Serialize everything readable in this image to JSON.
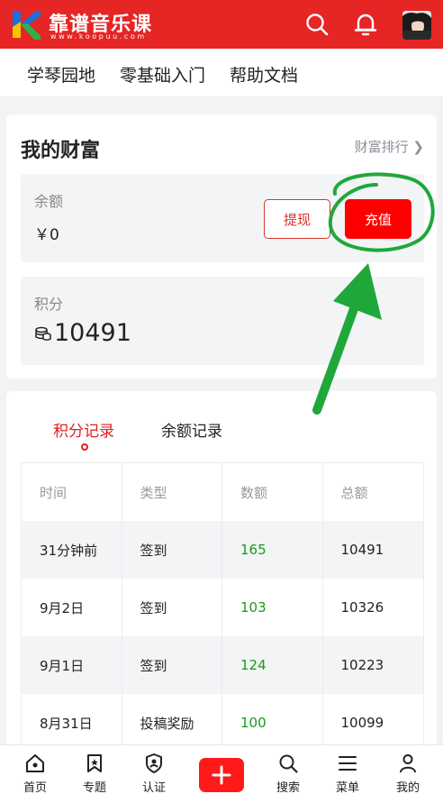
{
  "header": {
    "logo_title": "靠谱音乐课",
    "logo_subtitle": "www.koopuu.com",
    "icons": [
      "search-icon",
      "bell-icon",
      "avatar"
    ],
    "brand_color": "#e62525"
  },
  "subnav": {
    "items": [
      {
        "label": "学琴园地"
      },
      {
        "label": "零基础入门"
      },
      {
        "label": "帮助文档"
      }
    ]
  },
  "wealth": {
    "title": "我的财富",
    "rank_link": "财富排行 ❯",
    "balance_label": "余额",
    "balance_value": "￥0",
    "withdraw_label": "提现",
    "recharge_label": "充值",
    "points_label": "积分",
    "points_value": "10491"
  },
  "records": {
    "tabs": [
      {
        "label": "积分记录",
        "active": true
      },
      {
        "label": "余额记录",
        "active": false
      }
    ],
    "columns": [
      "时间",
      "类型",
      "数额",
      "总额"
    ],
    "rows": [
      [
        "31分钟前",
        "签到",
        "165",
        "10491"
      ],
      [
        "9月2日",
        "签到",
        "103",
        "10326"
      ],
      [
        "9月1日",
        "签到",
        "124",
        "10223"
      ],
      [
        "8月31日",
        "投稿奖励",
        "100",
        "10099"
      ]
    ],
    "amount_color": "#1a9a1a"
  },
  "bottom_nav": {
    "items": [
      {
        "label": "首页",
        "icon": "home-icon"
      },
      {
        "label": "专题",
        "icon": "bookmark-icon"
      },
      {
        "label": "认证",
        "icon": "shield-user-icon"
      },
      {
        "label": "",
        "icon": "plus-icon"
      },
      {
        "label": "搜索",
        "icon": "search-icon"
      },
      {
        "label": "菜单",
        "icon": "menu-icon"
      },
      {
        "label": "我的",
        "icon": "user-icon"
      }
    ]
  }
}
